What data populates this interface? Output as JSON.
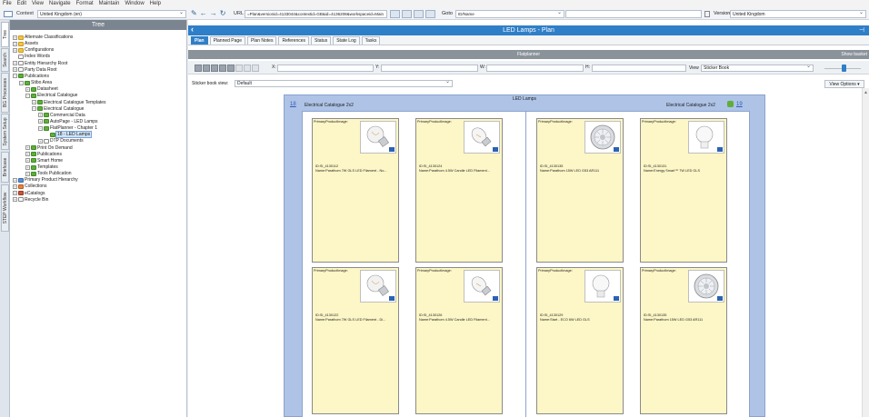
{
  "menu": [
    "File",
    "Edit",
    "View",
    "Navigate",
    "Format",
    "Maintain",
    "Window",
    "Help"
  ],
  "context": {
    "label": "Context",
    "value": "United Kingdom (en)"
  },
  "url": {
    "label": "URL",
    "value": "=Plan&versionid=4133044&contextid=GB&id=4136208&workspaceid=Main"
  },
  "goto": {
    "label": "Goto",
    "value": "ID/Name"
  },
  "version": {
    "label": "Version",
    "value": "United Kingdom"
  },
  "vtabs": [
    "Tree",
    "Search",
    "BG Processes",
    "System Setup",
    "Briefcase",
    "STEP Workflow"
  ],
  "tree": {
    "header": "Tree",
    "items": [
      {
        "label": "Alternate Classifications",
        "level": 0,
        "exp": "+",
        "icon": "folder"
      },
      {
        "label": "Assets",
        "level": 0,
        "exp": "+",
        "icon": "folder"
      },
      {
        "label": "Configurations",
        "level": 0,
        "exp": "+",
        "icon": "folder"
      },
      {
        "label": "Index Words",
        "level": 0,
        "exp": "",
        "icon": "plain"
      },
      {
        "label": "Entity Hierarchy Root",
        "level": 0,
        "exp": "+",
        "icon": "plain"
      },
      {
        "label": "Party Data Root",
        "level": 0,
        "exp": "+",
        "icon": "plain"
      },
      {
        "label": "Publications",
        "level": 0,
        "exp": "−",
        "icon": "green"
      },
      {
        "label": "Stibo Area",
        "level": 1,
        "exp": "−",
        "icon": "green"
      },
      {
        "label": "Datasheet",
        "level": 2,
        "exp": "+",
        "icon": "green"
      },
      {
        "label": "Electrical Catalogue",
        "level": 2,
        "exp": "−",
        "icon": "green"
      },
      {
        "label": "Electrical Catalogue Templates",
        "level": 3,
        "exp": "+",
        "icon": "green"
      },
      {
        "label": "Electrical Catalogue",
        "level": 3,
        "exp": "−",
        "icon": "green"
      },
      {
        "label": "Commercial Data",
        "level": 4,
        "exp": "+",
        "icon": "green"
      },
      {
        "label": "AutoPage - LED Lamps",
        "level": 4,
        "exp": "+",
        "icon": "green"
      },
      {
        "label": "FlatPlanner - Chapter 1",
        "level": 4,
        "exp": "−",
        "icon": "green"
      },
      {
        "label": "18 - LED Lamps",
        "level": 5,
        "exp": "",
        "icon": "green",
        "selected": true
      },
      {
        "label": "DTP Documents",
        "level": 4,
        "exp": "+",
        "icon": "plain"
      },
      {
        "label": "Print On Demand",
        "level": 2,
        "exp": "+",
        "icon": "green"
      },
      {
        "label": "Publications",
        "level": 2,
        "exp": "+",
        "icon": "green"
      },
      {
        "label": "Smart Home",
        "level": 2,
        "exp": "+",
        "icon": "green"
      },
      {
        "label": "Templates",
        "level": 2,
        "exp": "+",
        "icon": "green"
      },
      {
        "label": "Tools Publication",
        "level": 2,
        "exp": "+",
        "icon": "green"
      },
      {
        "label": "Primary Product Hierarchy",
        "level": 0,
        "exp": "+",
        "icon": "blue"
      },
      {
        "label": "Collections",
        "level": 0,
        "exp": "+",
        "icon": "orange"
      },
      {
        "label": "eCatalogs",
        "level": 0,
        "exp": "+",
        "icon": "red"
      },
      {
        "label": "Recycle Bin",
        "level": 0,
        "exp": "+",
        "icon": "plain"
      }
    ]
  },
  "main": {
    "title": "LED Lamps - Plan",
    "tabs": [
      "Plan",
      "Planned Page",
      "Plan Notes",
      "References",
      "Status",
      "State Log",
      "Tasks"
    ],
    "active_tab": 0,
    "flatplanner": "Flatplanner",
    "show_basket": "Show basket",
    "coords": {
      "x": "X:",
      "y": "Y:",
      "w": "W:",
      "h": "H:"
    },
    "view_label": "View",
    "view_value": "Sticker Book",
    "sticker_label": "Sticker book view:",
    "sticker_value": "Default",
    "view_options": "View Options"
  },
  "spread": {
    "title": "LED Lamps",
    "left_page_num": "18",
    "left_page_name": "Electrical Catalogue 2x2",
    "right_page_name": "Electrical Catalogue 2x2",
    "right_page_num": "19",
    "cells": [
      {
        "cap": "PrimaryProductImage:",
        "id": "ID:SI_4130112",
        "name": "Name:Parathom 7W GLS LED Filament - No...",
        "bulb": "gls"
      },
      {
        "cap": "PrimaryProductImage:",
        "id": "ID:SI_4130124",
        "name": "Name:Parathom 4.5W Candle LED Filament...",
        "bulb": "candle"
      },
      {
        "cap": "PrimaryProductImage:",
        "id": "ID:SI_4130135",
        "name": "Name:Parathom 15W LED G53 AR111",
        "bulb": "ar111"
      },
      {
        "cap": "PrimaryProductImage:",
        "id": "ID:SI_4130131",
        "name": "Name:Energy Smart™ 7W LED GLS",
        "bulb": "smart"
      },
      {
        "cap": "PrimaryProductImage:",
        "id": "ID:SI_4130122",
        "name": "Name:Parathom 7W GLS LED Filament - Di...",
        "bulb": "gls"
      },
      {
        "cap": "PrimaryProductImage:",
        "id": "ID:SI_4130126",
        "name": "Name:Parathom 4.5W Candle LED Filament...",
        "bulb": "candle"
      },
      {
        "cap": "PrimaryProductImage:",
        "id": "ID:SI_4130129",
        "name": "Name:Start - ECO 6W LED GLS",
        "bulb": "eco"
      },
      {
        "cap": "PrimaryProductImage:",
        "id": "ID:SI_4130135",
        "name": "Name:Parathom 15W LED G53 AR111",
        "bulb": "ar111"
      }
    ]
  }
}
